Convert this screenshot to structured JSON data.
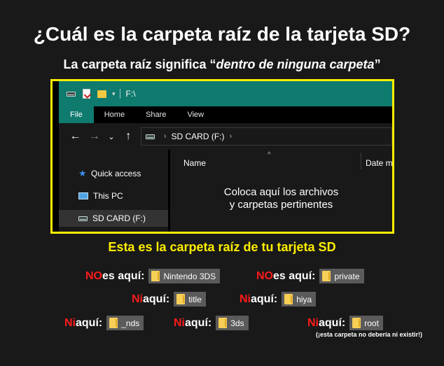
{
  "heading": {
    "title": "¿Cuál es la carpeta raíz de la tarjeta SD?",
    "subtitle_prefix": "La carpeta raíz significa “",
    "subtitle_italic": "dentro de ninguna carpeta",
    "subtitle_suffix": "”"
  },
  "explorer": {
    "window_path": "F:\\",
    "ribbon_tabs": [
      "File",
      "Home",
      "Share",
      "View"
    ],
    "address": "SD CARD (F:)",
    "nav_items": [
      "Quick access",
      "This PC",
      "SD CARD (F:)"
    ],
    "selected_nav": "SD CARD (F:)",
    "columns": [
      "Name",
      "Date m"
    ],
    "empty_message_line1": "Coloca aquí los archivos",
    "empty_message_line2": "y carpetas pertinentes",
    "colors": {
      "titlebar": "#0f7a6e",
      "frame": "#ffee00"
    }
  },
  "root_caption": "Esta es la carpeta raíz de tu tarjeta SD",
  "examples": {
    "row1": [
      {
        "neg": "NO",
        "rest": " es aquí:",
        "folder": "Nintendo 3DS"
      },
      {
        "neg": "NO",
        "rest": " es aquí:",
        "folder": "private"
      }
    ],
    "row2": [
      {
        "neg": "Ni",
        "rest": " aquí:",
        "folder": "title"
      },
      {
        "neg": "Ni",
        "rest": " aquí:",
        "folder": "hiya"
      }
    ],
    "row3": [
      {
        "neg": "Ni",
        "rest": " aquí:",
        "folder": "_nds"
      },
      {
        "neg": "Ni",
        "rest": " aquí:",
        "folder": "3ds"
      },
      {
        "neg": "Ni",
        "rest": " aquí:",
        "folder": "root"
      }
    ],
    "root_note": "(¡esta carpeta no debería ni existir!)"
  }
}
